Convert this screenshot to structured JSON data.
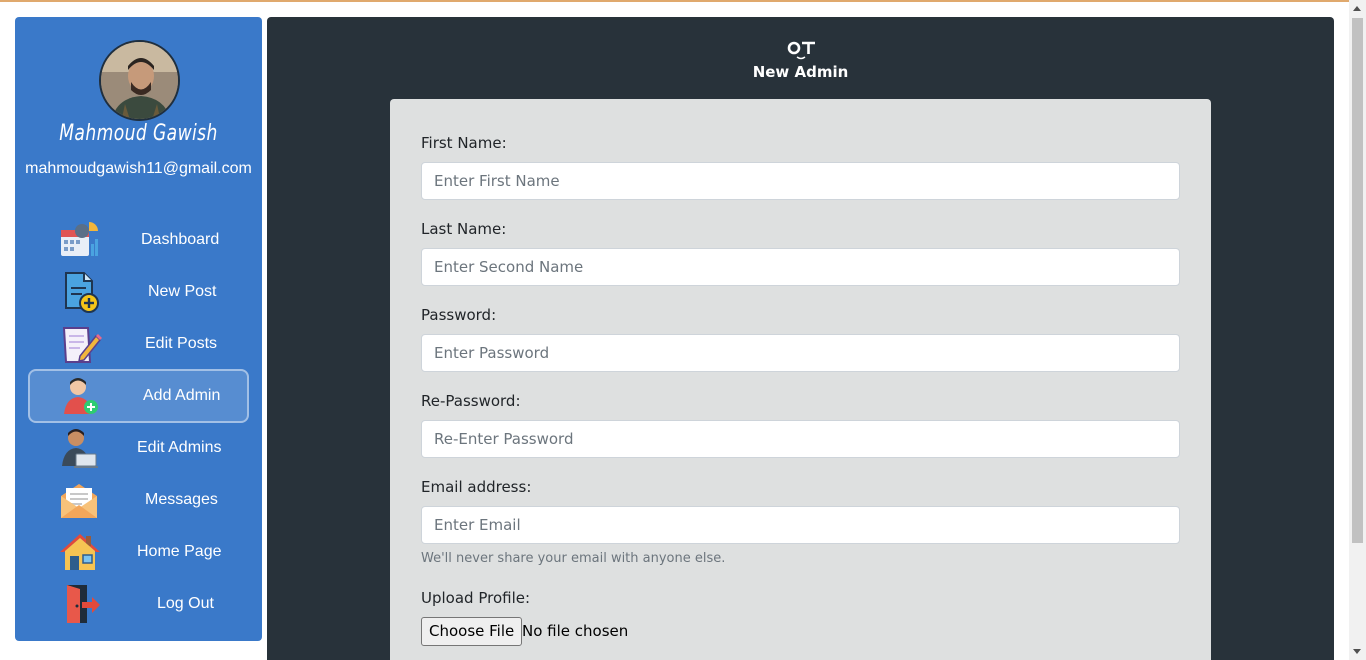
{
  "user": {
    "name": "Mahmoud Gawish",
    "email": "mahmoudgawish11@gmail.com"
  },
  "sidebar": {
    "items": [
      {
        "label": "Dashboard",
        "icon": "dashboard-icon"
      },
      {
        "label": "New Post",
        "icon": "new-post-icon"
      },
      {
        "label": "Edit Posts",
        "icon": "edit-posts-icon"
      },
      {
        "label": "Add Admin",
        "icon": "add-admin-icon",
        "active": true
      },
      {
        "label": "Edit Admins",
        "icon": "edit-admins-icon"
      },
      {
        "label": "Messages",
        "icon": "messages-icon"
      },
      {
        "label": "Home Page",
        "icon": "home-icon"
      },
      {
        "label": "Log Out",
        "icon": "logout-icon"
      }
    ]
  },
  "header": {
    "logo_text": "OT",
    "title": "New Admin"
  },
  "form": {
    "first_name": {
      "label": "First Name:",
      "placeholder": "Enter First Name",
      "value": ""
    },
    "last_name": {
      "label": "Last Name:",
      "placeholder": "Enter Second Name",
      "value": ""
    },
    "password": {
      "label": "Password:",
      "placeholder": "Enter Password",
      "value": ""
    },
    "re_password": {
      "label": "Re-Password:",
      "placeholder": "Re-Enter Password",
      "value": ""
    },
    "email": {
      "label": "Email address:",
      "placeholder": "Enter Email",
      "value": "",
      "help": "We'll never share your email with anyone else."
    },
    "upload": {
      "label": "Upload Profile:",
      "button": "Choose File",
      "status": "No file chosen"
    }
  },
  "colors": {
    "sidebar_bg": "#3a79c9",
    "main_bg": "#28323a",
    "form_bg": "#dee0e0"
  }
}
